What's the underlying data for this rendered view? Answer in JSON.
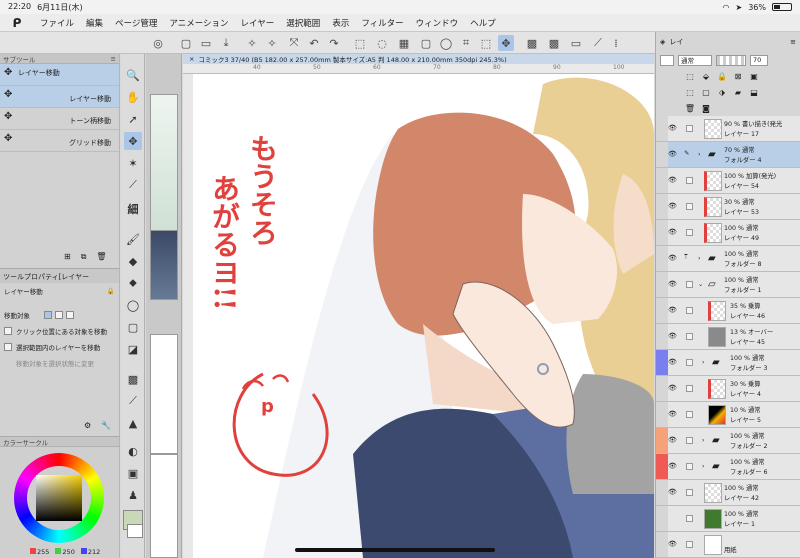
{
  "status": {
    "time": "22:20",
    "date": "6月11日(木)",
    "battery": "36%"
  },
  "menu": [
    "ファイル",
    "編集",
    "ページ管理",
    "アニメーション",
    "レイヤー",
    "選択範囲",
    "表示",
    "フィルター",
    "ウィンドウ",
    "ヘルプ"
  ],
  "subtool": {
    "tab": "サブツール",
    "items": [
      {
        "label": "レイヤー移動"
      },
      {
        "label": "レイヤー移動"
      },
      {
        "label": "トーン柄移動"
      },
      {
        "label": "グリッド移動"
      }
    ]
  },
  "toolprop": {
    "title": "ツールプロパティ[レイヤー",
    "name": "レイヤー移動",
    "target_label": "移動対象",
    "options": [
      "クリック位置にある対象を移動",
      "選択範囲内のレイヤーを移動",
      "移動対象を選択状態に変更"
    ]
  },
  "color": {
    "title": "カラーサークル",
    "r": "255",
    "g": "250",
    "b": "212"
  },
  "canvas": {
    "tab": "コミック3 37/40 (B5 182.00 x 257.00mm 製本サイズ:A5 判 148.00 x 210.00mm 350dpi 245.3%)",
    "ruler": [
      "40",
      "50",
      "60",
      "70",
      "80",
      "90",
      "100"
    ],
    "handwriting": [
      "もうそろ",
      "あがるヨ!!"
    ],
    "face_p": "p"
  },
  "layer_panel": {
    "tab": "レイ",
    "blend_mode": "通常",
    "opacity": "70",
    "layers": [
      {
        "line1": "90 % 書い描き(発光",
        "line2": "レイヤー 17",
        "type": "raster",
        "color": ""
      },
      {
        "line1": "70 % 通常",
        "line2": "フォルダー 4",
        "type": "folder",
        "color": "",
        "selected": true
      },
      {
        "line1": "100 % 加算(発光)",
        "line2": "レイヤー 54",
        "type": "raster",
        "color": ""
      },
      {
        "line1": "30 % 通常",
        "line2": "レイヤー 53",
        "type": "raster",
        "color": ""
      },
      {
        "line1": "100 % 通常",
        "line2": "レイヤー 49",
        "type": "raster",
        "color": ""
      },
      {
        "line1": "100 % 通常",
        "line2": "フォルダー 8",
        "type": "folder",
        "color": ""
      },
      {
        "line1": "100 % 通常",
        "line2": "フォルダー 1",
        "type": "folder",
        "color": ""
      },
      {
        "line1": "35 % 乗算",
        "line2": "レイヤー 46",
        "type": "raster",
        "color": ""
      },
      {
        "line1": "13 % オーバー",
        "line2": "レイヤー 45",
        "type": "raster",
        "color": ""
      },
      {
        "line1": "100 % 通常",
        "line2": "フォルダー 3",
        "type": "folder",
        "color": "#7a7ff0"
      },
      {
        "line1": "30 % 乗算",
        "line2": "レイヤー 4",
        "type": "raster",
        "color": ""
      },
      {
        "line1": "10 % 通常",
        "line2": "レイヤー 5",
        "type": "raster",
        "color": ""
      },
      {
        "line1": "100 % 通常",
        "line2": "フォルダー 2",
        "type": "folder",
        "color": "#f5a27a"
      },
      {
        "line1": "100 % 通常",
        "line2": "フォルダー 6",
        "type": "folder",
        "color": "#ef5a55"
      },
      {
        "line1": "100 % 通常",
        "line2": "レイヤー 42",
        "type": "raster",
        "color": ""
      },
      {
        "line1": "100 % 通常",
        "line2": "レイヤー 1",
        "type": "raster",
        "color": ""
      },
      {
        "line1": "",
        "line2": "用紙",
        "type": "paper",
        "color": ""
      }
    ]
  }
}
